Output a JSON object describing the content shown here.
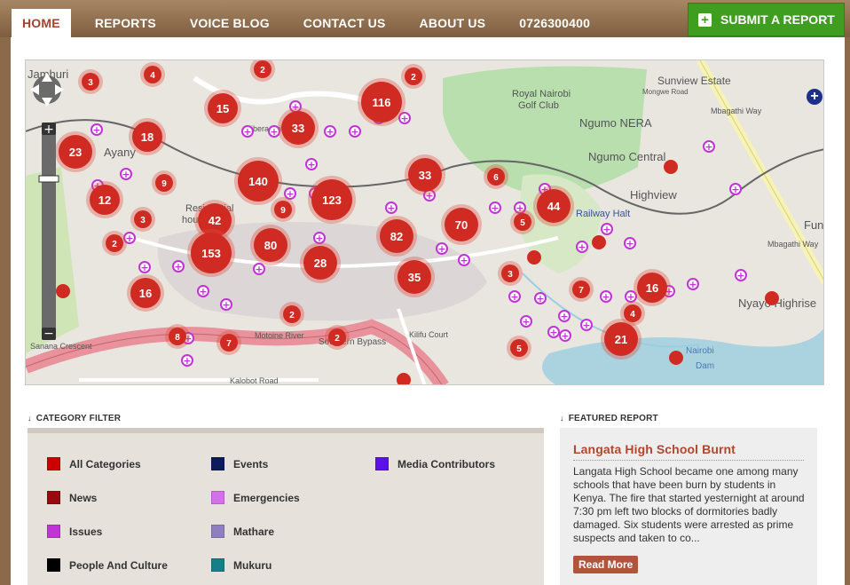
{
  "nav": {
    "items": [
      {
        "label": "HOME",
        "active": true
      },
      {
        "label": "REPORTS"
      },
      {
        "label": "VOICE BLOG"
      },
      {
        "label": "CONTACT US"
      },
      {
        "label": "ABOUT US"
      },
      {
        "label": "0726300400"
      }
    ],
    "submit_label": "SUBMIT A REPORT"
  },
  "map": {
    "place_labels": [
      {
        "text": "Sunview Estate"
      },
      {
        "text": "Royal Nairobi"
      },
      {
        "text": "Golf Club"
      },
      {
        "text": "Ngumo NERA"
      },
      {
        "text": "Ngumo Central"
      },
      {
        "text": "Highview"
      },
      {
        "text": "Ayany"
      },
      {
        "text": "Residential"
      },
      {
        "text": "houses"
      },
      {
        "text": "Railway Halt"
      },
      {
        "text": "Nyayo Highrise"
      },
      {
        "text": "Nairobi"
      },
      {
        "text": "Dam"
      },
      {
        "text": "Southern Bypass"
      },
      {
        "text": "Kalobot Road"
      },
      {
        "text": "Kilifu Court"
      },
      {
        "text": "Sanana Crescent"
      },
      {
        "text": "Mbagathi Way"
      },
      {
        "text": "Mbagathi Way"
      },
      {
        "text": "Jamhuri"
      },
      {
        "text": "Fun"
      },
      {
        "text": "Kibera Drive"
      },
      {
        "text": "Mongwe Road"
      },
      {
        "text": "Motoine River"
      }
    ],
    "clusters": [
      {
        "n": "3"
      },
      {
        "n": "4"
      },
      {
        "n": "2"
      },
      {
        "n": "2"
      },
      {
        "n": "116"
      },
      {
        "n": "15"
      },
      {
        "n": "33"
      },
      {
        "n": "18"
      },
      {
        "n": "23"
      },
      {
        "n": "9"
      },
      {
        "n": "140"
      },
      {
        "n": "33"
      },
      {
        "n": "6"
      },
      {
        "n": "12"
      },
      {
        "n": "123"
      },
      {
        "n": "9"
      },
      {
        "n": "3"
      },
      {
        "n": "42"
      },
      {
        "n": "44"
      },
      {
        "n": "70"
      },
      {
        "n": "5"
      },
      {
        "n": "2"
      },
      {
        "n": "153"
      },
      {
        "n": "80"
      },
      {
        "n": "82"
      },
      {
        "n": "28"
      },
      {
        "n": "16"
      },
      {
        "n": "35"
      },
      {
        "n": "3"
      },
      {
        "n": "7"
      },
      {
        "n": "16"
      },
      {
        "n": "2"
      },
      {
        "n": "4"
      },
      {
        "n": "8"
      },
      {
        "n": "7"
      },
      {
        "n": "2"
      },
      {
        "n": "21"
      },
      {
        "n": "5"
      }
    ]
  },
  "filter": {
    "heading": "CATEGORY FILTER",
    "categories": [
      {
        "label": "All Categories",
        "color": "#cc0000"
      },
      {
        "label": "Events",
        "color": "#0c1b5c"
      },
      {
        "label": "Media Contributors",
        "color": "#5b12e8"
      },
      {
        "label": "News",
        "color": "#990a10"
      },
      {
        "label": "Emergencies",
        "color": "#d46fea"
      },
      {
        "label": "Issues",
        "color": "#c133d6"
      },
      {
        "label": "Mathare",
        "color": "#8e7fbe"
      },
      {
        "label": "People And Culture",
        "color": "#000000"
      },
      {
        "label": "Mukuru",
        "color": "#147f87"
      }
    ]
  },
  "featured": {
    "heading": "FEATURED REPORT",
    "title": "Langata High School Burnt",
    "text": "Langata High School became one among many schools that have been burn by students in Kenya. The fire that started yesternight at around 7:30 pm left two blocks of dormitories badly damaged. Six students were arrested as prime suspects and taken to co...",
    "button": "Read More"
  }
}
